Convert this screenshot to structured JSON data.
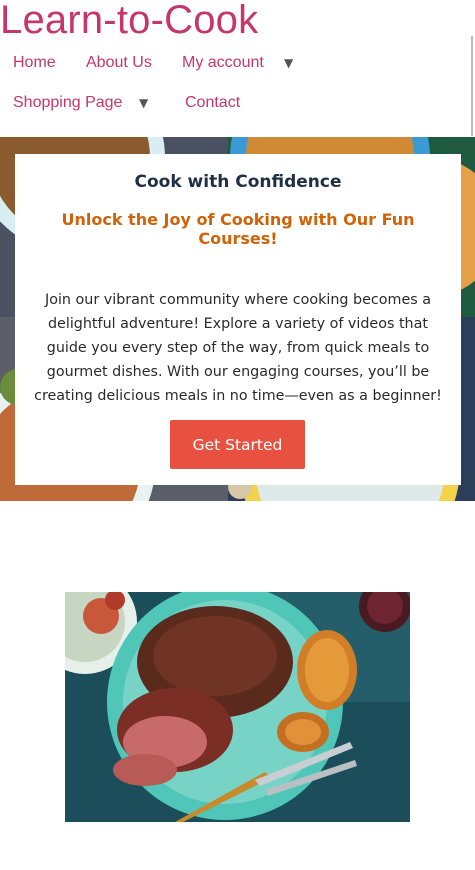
{
  "site": {
    "title": "Learn-to-Cook"
  },
  "nav": {
    "home": "Home",
    "about": "About Us",
    "account": "My account",
    "shopping": "Shopping Page",
    "contact": "Contact"
  },
  "hero": {
    "heading": "Cook with Confidence",
    "subheading": "Unlock the Joy of Cooking with Our Fun Courses!",
    "body": "Join our vibrant community where cooking becomes a delightful adventure! Explore a variety of videos that guide you every step of the way, from quick meals to gourmet dishes. With our engaging courses, you’ll be creating delicious meals in no time—even as a beginner!",
    "cta_label": "Get Started"
  },
  "colors": {
    "brand": "#c6366b",
    "accent_orange": "#d0620a",
    "cta": "#e8513f",
    "heading_dark": "#1f3046"
  },
  "icons": {
    "dropdown": "caret-down-icon"
  }
}
